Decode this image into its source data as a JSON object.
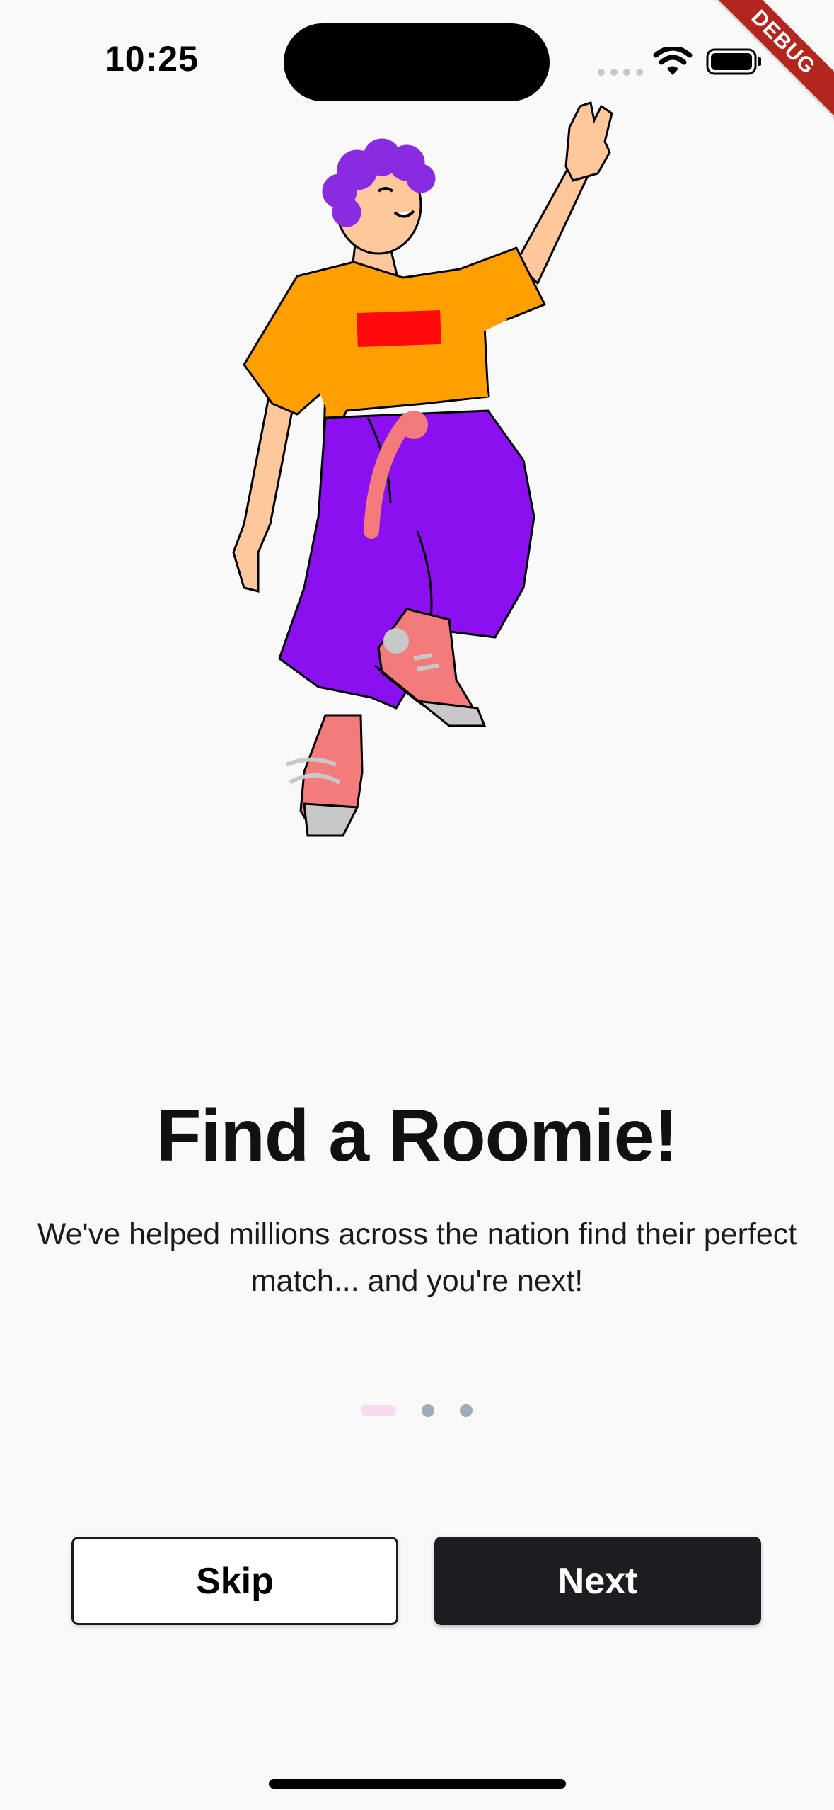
{
  "status_bar": {
    "time": "10:25",
    "wifi_icon": "wifi-icon",
    "battery_icon": "battery-icon"
  },
  "debug_banner": "DEBUG",
  "illustration": {
    "icon": "person-waving-illustration",
    "colors": {
      "hair": "#8a2be2",
      "shirt": "#ffa000",
      "shirt_patch": "#ff0a0a",
      "pants": "#8a10f0",
      "skin": "#ffc79c",
      "shoes": "#f47b7b",
      "soles": "#c8c8c8"
    }
  },
  "onboarding": {
    "title": "Find a Roomie!",
    "subtitle": "We've helped millions across the nation find their perfect match... and you're next!",
    "page_count": 3,
    "current_page": 1
  },
  "buttons": {
    "skip_label": "Skip",
    "next_label": "Next"
  },
  "colors": {
    "background": "#f9f9f9",
    "primary_button": "#1b1d21",
    "indicator_active": "#f9d9ef",
    "indicator_inactive": "#9eabb8"
  }
}
